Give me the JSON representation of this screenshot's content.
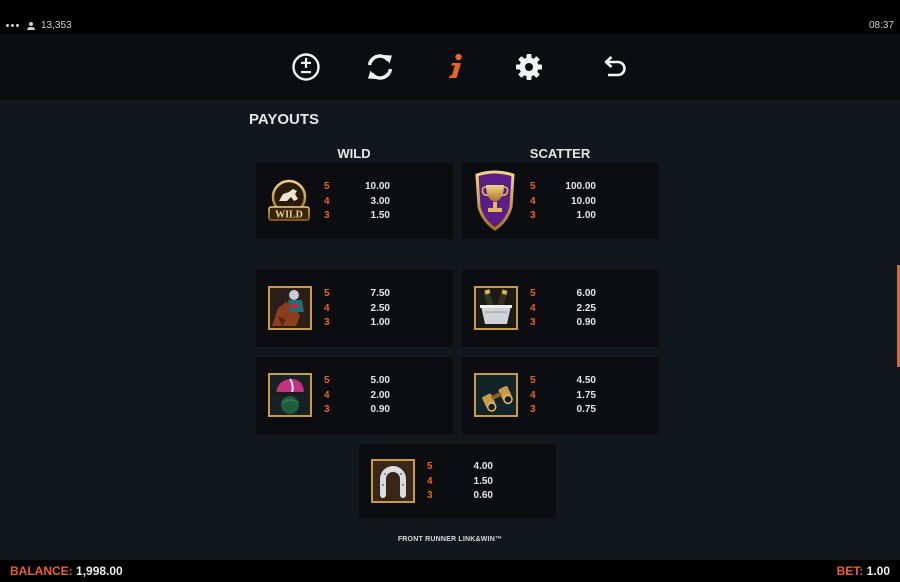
{
  "status": {
    "user_count": "13,353",
    "time": "08:37"
  },
  "toolbar": {
    "buttons": [
      {
        "name": "bet-adjust-icon"
      },
      {
        "name": "autoplay-icon"
      },
      {
        "name": "info-icon",
        "active_color": "#e8632a"
      },
      {
        "name": "gear-icon"
      },
      {
        "name": "back-arrow-icon"
      }
    ]
  },
  "page": {
    "title": "PAYOUTS",
    "wild_heading": "WILD",
    "scatter_heading": "SCATTER",
    "footer": "FRONT RUNNER LINK&WIN™"
  },
  "symbols": [
    {
      "id": "wild",
      "icon": "wild-horse-badge-icon",
      "pays": [
        {
          "count": "5",
          "value": "10.00"
        },
        {
          "count": "4",
          "value": "3.00"
        },
        {
          "count": "3",
          "value": "1.50"
        }
      ]
    },
    {
      "id": "scatter",
      "icon": "trophy-shield-icon",
      "pays": [
        {
          "count": "5",
          "value": "100.00"
        },
        {
          "count": "4",
          "value": "10.00"
        },
        {
          "count": "3",
          "value": "1.00"
        }
      ]
    },
    {
      "id": "jockey",
      "icon": "jockey-horse-icon",
      "pays": [
        {
          "count": "5",
          "value": "7.50"
        },
        {
          "count": "4",
          "value": "2.50"
        },
        {
          "count": "3",
          "value": "1.00"
        }
      ]
    },
    {
      "id": "champagne",
      "icon": "champagne-bucket-icon",
      "pays": [
        {
          "count": "5",
          "value": "6.00"
        },
        {
          "count": "4",
          "value": "2.25"
        },
        {
          "count": "3",
          "value": "0.90"
        }
      ]
    },
    {
      "id": "helmet",
      "icon": "jockey-helmet-icon",
      "pays": [
        {
          "count": "5",
          "value": "5.00"
        },
        {
          "count": "4",
          "value": "2.00"
        },
        {
          "count": "3",
          "value": "0.90"
        }
      ]
    },
    {
      "id": "binoculars",
      "icon": "binoculars-icon",
      "pays": [
        {
          "count": "5",
          "value": "4.50"
        },
        {
          "count": "4",
          "value": "1.75"
        },
        {
          "count": "3",
          "value": "0.75"
        }
      ]
    },
    {
      "id": "horseshoe",
      "icon": "horseshoe-icon",
      "pays": [
        {
          "count": "5",
          "value": "4.00"
        },
        {
          "count": "4",
          "value": "1.50"
        },
        {
          "count": "3",
          "value": "0.60"
        }
      ]
    }
  ],
  "footer_bar": {
    "balance_label": "BALANCE:",
    "balance_value": "1,998.00",
    "bet_label": "BET:",
    "bet_value": "1.00"
  },
  "colors": {
    "accent": "#e8632a",
    "background": "#12161d",
    "card": "#0b0d11"
  }
}
